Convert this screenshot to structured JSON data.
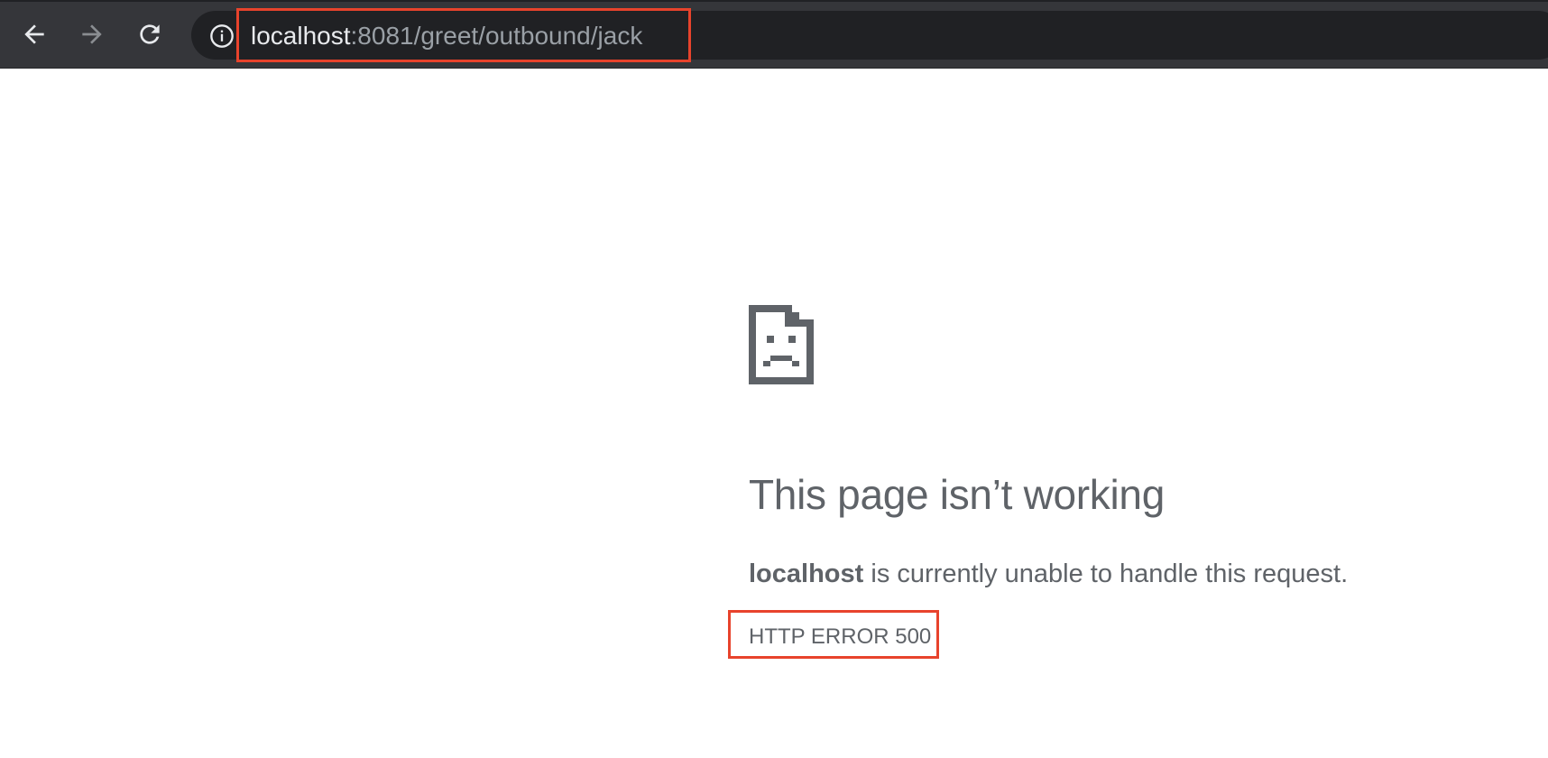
{
  "browser": {
    "back_icon": "arrow-left-icon",
    "forward_icon": "arrow-right-icon",
    "reload_icon": "reload-icon",
    "info_icon": "info-icon",
    "url_host": "localhost",
    "url_rest": ":8081/greet/outbound/jack",
    "colors": {
      "toolbar": "#35363a",
      "omnibox": "#202124",
      "url_host": "#e8eaed",
      "url_path": "#9aa0a6",
      "highlight": "#e8432c"
    }
  },
  "error_page": {
    "icon": "sad-page-icon",
    "title": "This page isn’t working",
    "desc_host": "localhost",
    "desc_text": " is currently unable to handle this request.",
    "code": "HTTP ERROR 500",
    "text_color": "#5f6368"
  }
}
